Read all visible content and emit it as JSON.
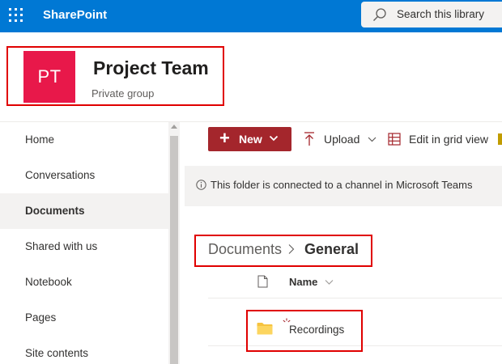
{
  "suite_bar": {
    "app_name": "SharePoint",
    "search_placeholder": "Search this library",
    "accent": "#0078d4"
  },
  "site": {
    "logo_initials": "PT",
    "logo_color": "#e8184a",
    "title": "Project Team",
    "subtitle": "Private group"
  },
  "nav": {
    "items": [
      {
        "label": "Home",
        "active": false
      },
      {
        "label": "Conversations",
        "active": false
      },
      {
        "label": "Documents",
        "active": true
      },
      {
        "label": "Shared with us",
        "active": false
      },
      {
        "label": "Notebook",
        "active": false
      },
      {
        "label": "Pages",
        "active": false
      },
      {
        "label": "Site contents",
        "active": false
      }
    ]
  },
  "command_bar": {
    "new_label": "New",
    "upload_label": "Upload",
    "grid_label": "Edit in grid view",
    "new_color": "#a4262c"
  },
  "info_bar": {
    "text": "This folder is connected to a channel in Microsoft Teams"
  },
  "breadcrumb": {
    "items": [
      "Documents",
      "General"
    ]
  },
  "list": {
    "column_name": "Name",
    "rows": [
      {
        "name": "Recordings",
        "type": "folder",
        "icon": "folder-icon"
      }
    ]
  },
  "annotation_color": "#e00000"
}
